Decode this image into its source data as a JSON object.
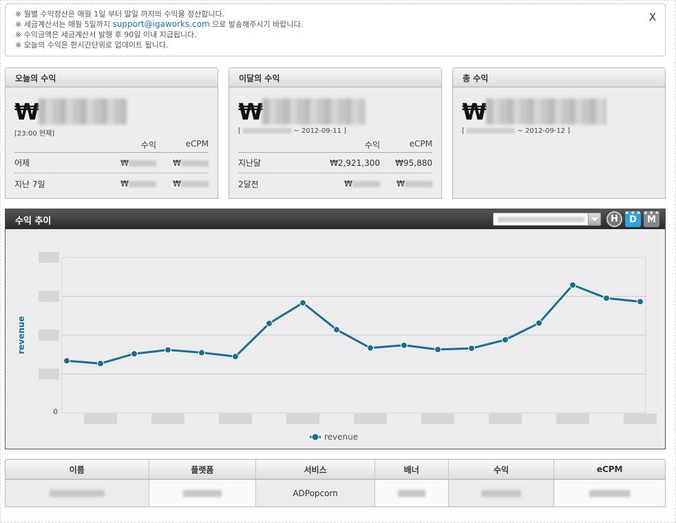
{
  "notice": {
    "lines": [
      "※ 월별 수익정산은 매월 1일 부터 말일 까지의 수익을 정산합니다.",
      "※ 세금계산서는 매월 5일까지",
      "※ 수익금액은 세금계산서 발행 후 90일 이내 지급됩니다.",
      "※ 오늘의 수익은 한시간단위로 업데이트 됩니다."
    ],
    "email": "support@igaworks.com",
    "line2_suffix": "으로 발송해주시기 바랍니다.",
    "close_label": "X"
  },
  "today": {
    "title": "오늘의 수익",
    "amount_prefix": "₩",
    "asof": "[23:00 현재]",
    "col_revenue": "수익",
    "col_ecpm": "eCPM",
    "rows": [
      {
        "label": "어제",
        "revenue": "₩",
        "ecpm": "₩"
      },
      {
        "label": "지난 7일",
        "revenue": "₩",
        "ecpm": "₩"
      }
    ]
  },
  "month": {
    "title": "이달의 수익",
    "amount_prefix": "₩",
    "range_prefix": "[",
    "range_end": "~ 2012-09-11 ]",
    "col_revenue": "수익",
    "col_ecpm": "eCPM",
    "rows": [
      {
        "label": "지난달",
        "revenue": "₩2,921,300",
        "ecpm": "₩95,880"
      },
      {
        "label": "2달전",
        "revenue": "₩",
        "ecpm": "₩"
      }
    ]
  },
  "total": {
    "title": "총 수익",
    "amount_prefix": "₩",
    "range_prefix": "[",
    "range_end": "~ 2012-09-12 ]"
  },
  "trend": {
    "title": "수익 추이",
    "btn_h": "H",
    "btn_d": "D",
    "btn_m": "M",
    "accent": "#176f94"
  },
  "chart_data": {
    "type": "line",
    "ylabel": "revenue",
    "y_tick_zero": "0",
    "ylim": [
      0,
      4
    ],
    "grid": true,
    "legend_position": "bottom-center",
    "series": [
      {
        "name": "revenue",
        "color": "#176f94",
        "values": [
          1.34,
          1.27,
          1.52,
          1.62,
          1.55,
          1.45,
          2.3,
          2.83,
          2.14,
          1.67,
          1.74,
          1.63,
          1.66,
          1.88,
          2.31,
          3.29,
          2.95,
          2.86
        ]
      }
    ]
  },
  "bottom_table": {
    "headers": [
      "이름",
      "플랫폼",
      "서비스",
      "배너",
      "수익",
      "eCPM"
    ],
    "row": {
      "service": "ADPopcorn"
    }
  }
}
